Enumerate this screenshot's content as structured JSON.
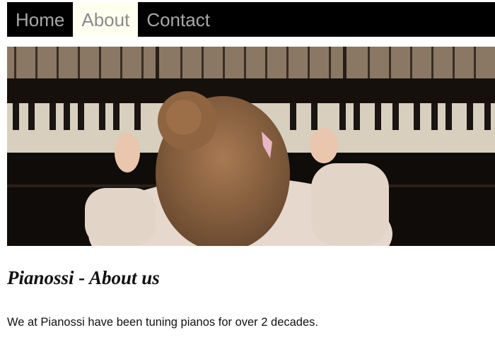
{
  "nav": {
    "items": [
      {
        "label": "Home",
        "active": false
      },
      {
        "label": "About",
        "active": true
      },
      {
        "label": "Contact",
        "active": false
      }
    ]
  },
  "hero": {
    "image": "photo of a child playing an upright piano"
  },
  "content": {
    "title": "Pianossi - About us",
    "intro": "We at Pianossi have been tuning pianos for over 2 decades."
  },
  "colors": {
    "nav_background": "#000000",
    "nav_text": "#a8a8a8",
    "nav_active_background": "#fffff0"
  }
}
